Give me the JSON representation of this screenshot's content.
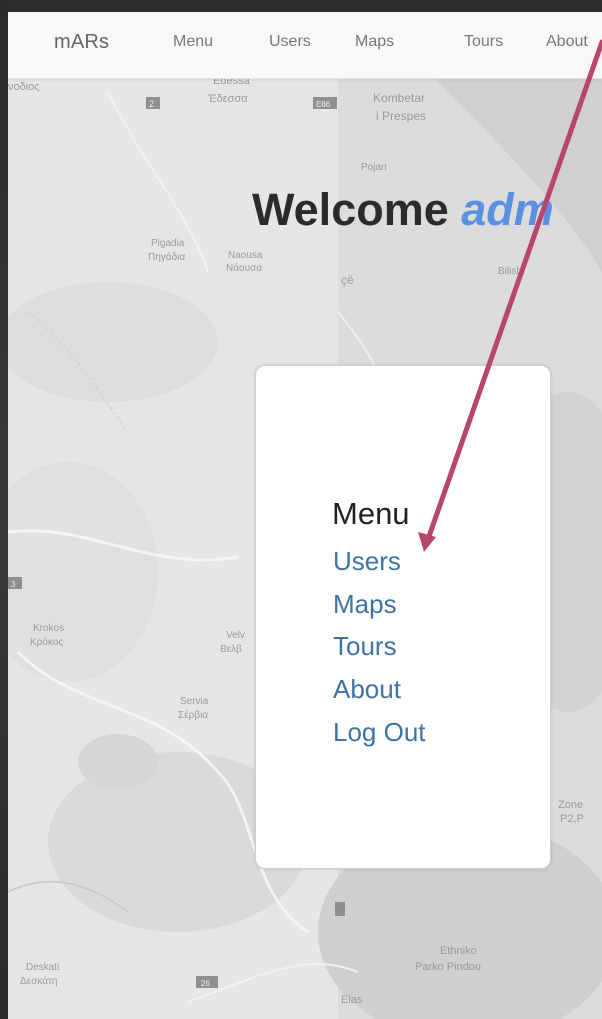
{
  "navbar": {
    "brand": "mARs",
    "links": [
      "Menu",
      "Users",
      "Maps",
      "Tours",
      "About"
    ]
  },
  "welcome": {
    "prefix": "Welcome",
    "user": "adm"
  },
  "menu_card": {
    "heading": "Menu",
    "links": [
      "Users",
      "Maps",
      "Tours",
      "About",
      "Log Out"
    ]
  },
  "map_labels": {
    "edessa": "Edessa",
    "edessa_gr": "Έδεσσα",
    "kombetar": "Kombetar",
    "prespes": "i Prespes",
    "pojan": "Pojan",
    "pigadia": "Pigadia",
    "pigadia_gr": "Πηγάδια",
    "naousa": "Naousa",
    "naousa_gr": "Νάουσα",
    "bilisht": "Bilisht",
    "ce": "çë",
    "krokos": "Krokos",
    "krokos_gr": "Κρόκος",
    "velv": "Velv",
    "velv_gr": "Βελβ",
    "servia": "Servia",
    "servia_gr": "Σέρβια",
    "deskati": "Deskati",
    "deskati_gr": "Δεσκάτη",
    "ethniko": "Ethniko",
    "parko_pindou": "Parko Pindou",
    "zone": "Zone",
    "p2p": "P2,P",
    "elas": "Elas",
    "vodios": "νοδιος",
    "road_2": "2",
    "road_e86": "E86",
    "road_26": "26",
    "road_3": "3"
  },
  "colors": {
    "navbar_bg": "#f8f8f8",
    "nav_text": "#777777",
    "welcome_user": "#5b8fe0",
    "menu_link": "#3f73a6",
    "annotation_arrow": "#b8456c"
  }
}
